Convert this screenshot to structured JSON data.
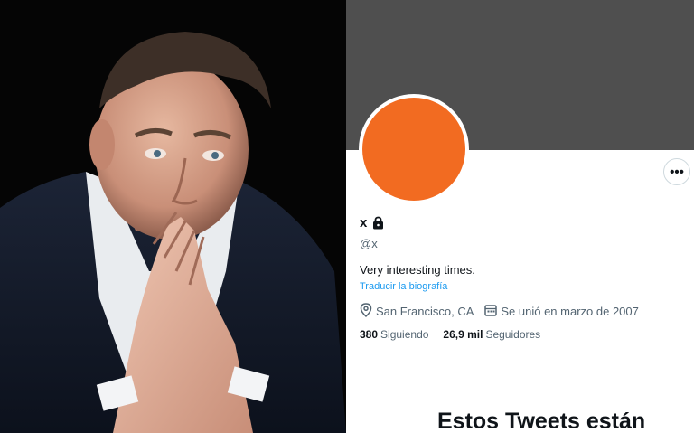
{
  "profile": {
    "banner_color": "#4f4f4f",
    "avatar_color": "#f26b21",
    "more_label": "•••",
    "display_name": "x",
    "handle": "@x",
    "bio": "Very interesting times.",
    "translate_bio": "Traducir la biografía",
    "location": "San Francisco, CA",
    "joined": "Se unió en marzo de 2007",
    "following_count": "380",
    "following_label": "Siguiendo",
    "followers_count": "26,9 mil",
    "followers_label": "Seguidores",
    "protected_title": "Estos Tweets están",
    "icons": {
      "verified": "lock-icon",
      "location": "location-pin-icon",
      "joined": "calendar-icon"
    }
  },
  "photo": {
    "description_icon": "portrait-photo"
  },
  "colors": {
    "link": "#1d9bf0",
    "secondary_text": "#536471",
    "primary_text": "#0f1419"
  }
}
